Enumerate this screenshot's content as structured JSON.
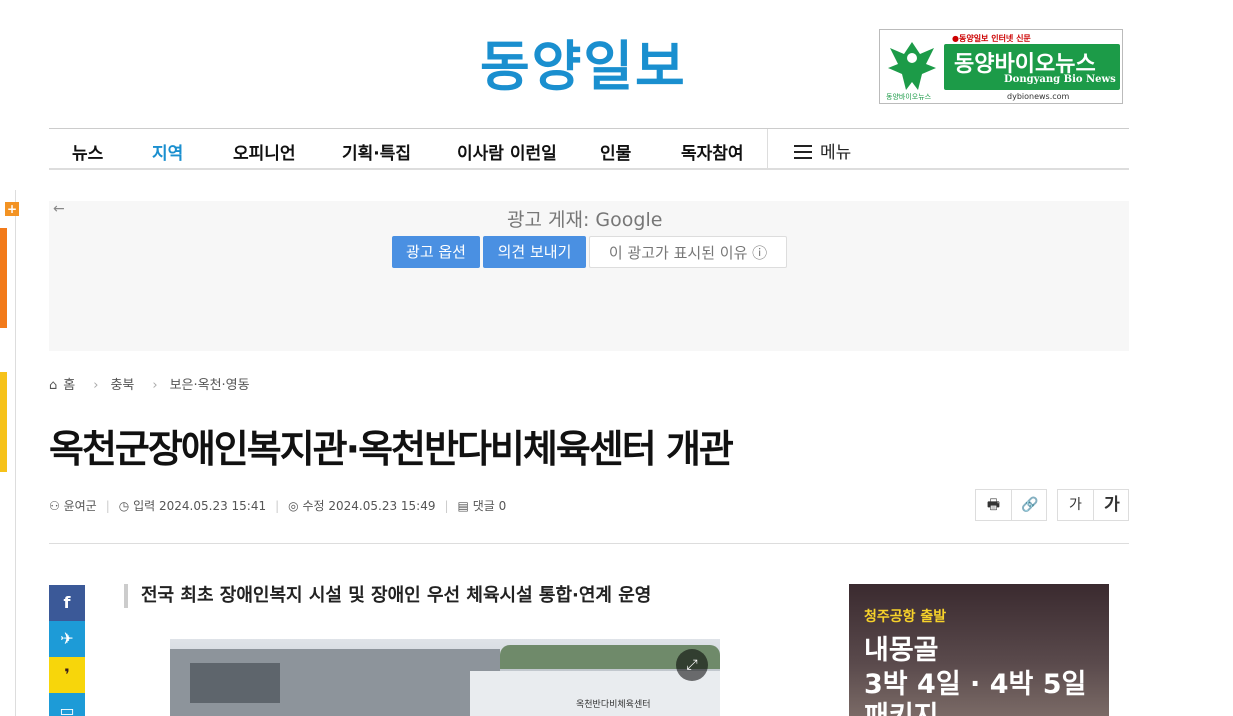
{
  "site": {
    "logo": "동양일보"
  },
  "banner": {
    "tagline": "●동양일보 인터넷 신문",
    "name_ko": "동양바이오뉴스",
    "name_en": "Dongyang Bio News",
    "url": "dybionews.com",
    "bird_label": "동양바이오뉴스"
  },
  "nav": {
    "items": [
      "뉴스",
      "지역",
      "오피니언",
      "기획·특집",
      "이사람 이런일",
      "인물",
      "독자참여"
    ],
    "active": "지역",
    "menu_label": "메뉴"
  },
  "ad": {
    "back": "←",
    "by_prefix": "광고 게재: ",
    "by_brand": "Google",
    "options": "광고 옵션",
    "feedback": "의견 보내기",
    "why": "이 광고가 표시된 이유 ⓘ"
  },
  "breadcrumb": {
    "home": "홈",
    "level1": "충북",
    "level2": "보은·옥천·영동"
  },
  "article": {
    "title": "옥천군장애인복지관·옥천반다비체육센터 개관",
    "author": "윤여군",
    "input_label": "입력",
    "input_time": "2024.05.23 15:41",
    "edit_label": "수정",
    "edit_time": "2024.05.23 15:49",
    "comments_label": "댓글",
    "comments_count": "0",
    "subtitle": "전국 최초 장애인복지 시설 및 장애인 우선 체육시설 통합·연계 운영",
    "photo_sign": "옥천반다비체육센터"
  },
  "tools": {
    "print": "🖶",
    "link": "🔗",
    "font_small": "가",
    "font_large": "가"
  },
  "side_ad": {
    "tag": "청주공항 출발",
    "line1": "내몽골",
    "line2": "3박 4일 · 4박 5일",
    "line3": "패키지"
  },
  "colors": {
    "brand": "#1a8fcf",
    "ad_button": "#4a90e2",
    "facebook": "#3b5998",
    "twitter": "#1d9bd7",
    "kakao": "#f7d60b"
  }
}
